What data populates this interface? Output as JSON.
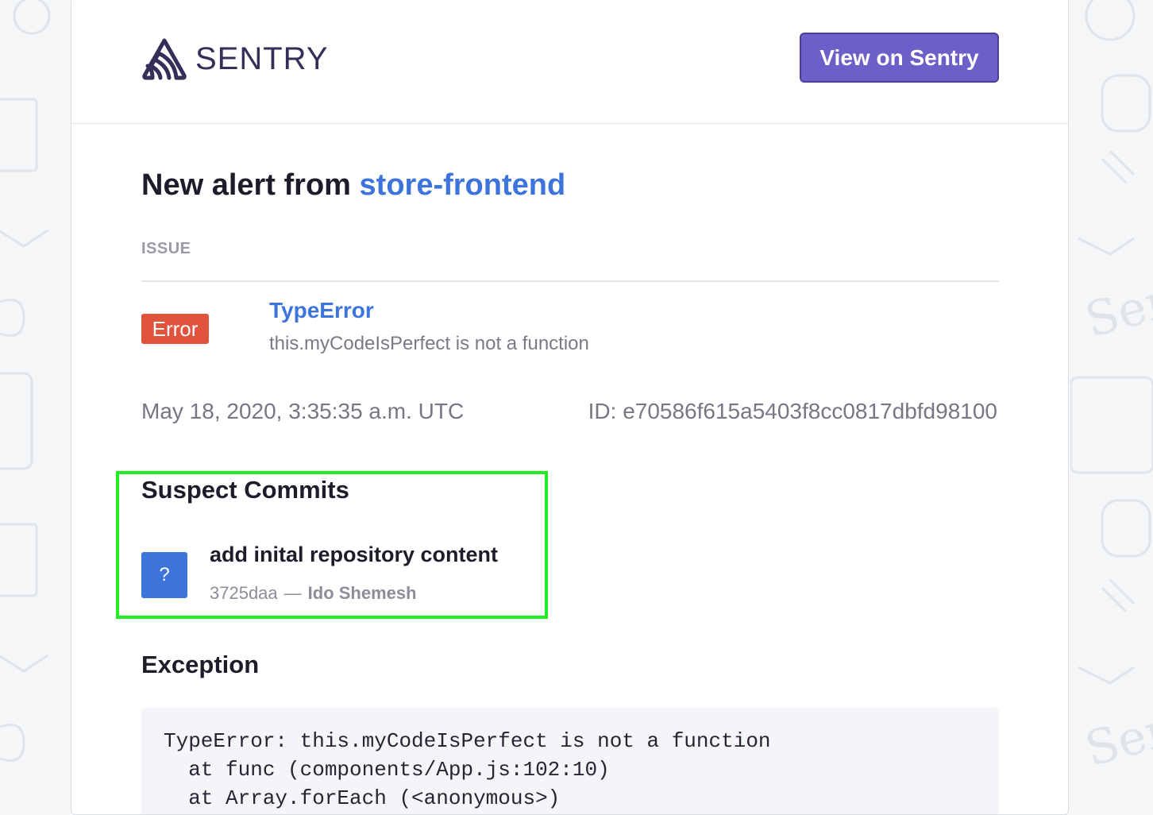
{
  "header": {
    "logo_text": "SENTRY",
    "view_button_label": "View on Sentry"
  },
  "alert": {
    "title_prefix": "New alert from",
    "project": "store-frontend",
    "section_label": "ISSUE",
    "level_badge": "Error",
    "issue_type": "TypeError",
    "issue_message": "this.myCodeIsPerfect is not a function",
    "timestamp": "May 18, 2020, 3:35:35 a.m. UTC",
    "event_id": "ID: e70586f615a5403f8cc0817dbfd98100"
  },
  "suspect_commits": {
    "title": "Suspect Commits",
    "items": [
      {
        "avatar": "?",
        "message": "add inital repository content",
        "sha": "3725daa",
        "separator": "—",
        "author": "Ido Shemesh"
      }
    ]
  },
  "exception": {
    "title": "Exception",
    "lines": [
      "TypeError: this.myCodeIsPerfect is not a function",
      "  at func (components/App.js:102:10)",
      "  at Array.forEach (<anonymous>)"
    ]
  },
  "colors": {
    "brand_purple": "#6c5fc7",
    "link_blue": "#3d74db",
    "error_red": "#e0533d",
    "highlight_green": "#21ee21"
  },
  "icons": {
    "logo": "sentry-logo-icon"
  }
}
